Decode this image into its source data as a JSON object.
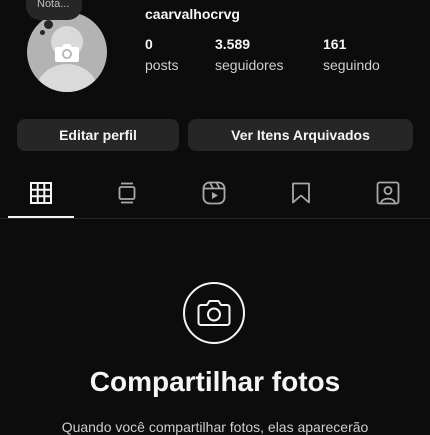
{
  "profile": {
    "note_placeholder": "Nota...",
    "username": "caarvalhocrvg",
    "stats": [
      {
        "value": "0",
        "label": "posts"
      },
      {
        "value": "3.589",
        "label": "seguidores"
      },
      {
        "value": "161",
        "label": "seguindo"
      }
    ],
    "avatar_icon": "camera-icon"
  },
  "actions": {
    "edit_profile": "Editar perfil",
    "archived": "Ver Itens Arquivados"
  },
  "tabs": [
    {
      "icon": "grid-icon",
      "active": true
    },
    {
      "icon": "feed-icon",
      "active": false
    },
    {
      "icon": "reels-icon",
      "active": false
    },
    {
      "icon": "bookmark-icon",
      "active": false
    },
    {
      "icon": "tagged-icon",
      "active": false
    }
  ],
  "empty_state": {
    "icon": "camera-icon",
    "title": "Compartilhar fotos",
    "subtitle": "Quando você compartilhar fotos, elas aparecerão"
  }
}
